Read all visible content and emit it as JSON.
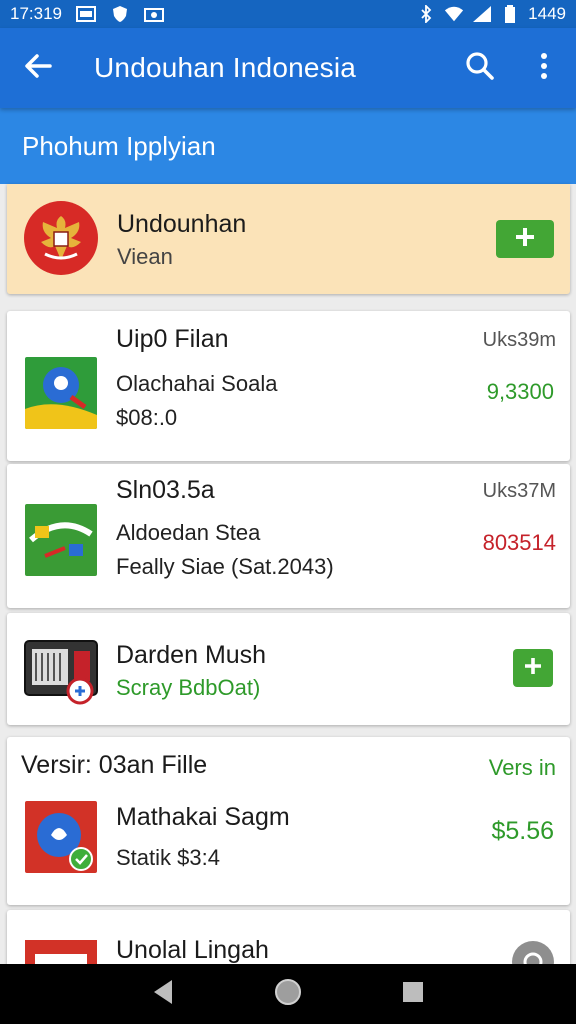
{
  "status_bar": {
    "time": "17:319",
    "battery_time": "1449",
    "icons_left": [
      "image-icon",
      "shield-icon",
      "photo-icon"
    ],
    "icons_right": [
      "bluetooth-icon",
      "wifi-icon",
      "signal-icon",
      "battery-icon"
    ]
  },
  "app_bar": {
    "title": "Undouhan Indonesia",
    "icons": [
      "back-arrow-icon",
      "search-icon",
      "more-vert-icon"
    ]
  },
  "sub_header": {
    "label": "Phohum Ipplyian"
  },
  "featured": {
    "title": "Undounhan",
    "subtitle": "Viean",
    "icon": "garuda-emblem-icon",
    "action_icon": "plus-icon"
  },
  "items": [
    {
      "title": "Uip0 Filan",
      "size": "Uks39m",
      "line1": "Olachahai Soala",
      "line2": "$08:.0",
      "price": "9,3300",
      "price_color": "#2e9a2a",
      "icon": "map-app-icon"
    },
    {
      "title": "Sln03.5a",
      "size": "Uks37M",
      "line1": "Aldoedan Stea",
      "line2": "Feally Siae (Sat.2043)",
      "price": "803514",
      "price_color": "#c5222a",
      "icon": "game-app-icon"
    },
    {
      "title": "Darden Mush",
      "subtitle": "Scray BdbOat)",
      "icon": "radio-app-icon",
      "action_icon": "plus-icon"
    }
  ],
  "version_card": {
    "header": "Versir: 03an Fille",
    "header_right": "Vers in",
    "title": "Mathakai Sagm",
    "subtitle": "Statik $3:4",
    "price": "$5.56",
    "icon": "bird-app-icon"
  },
  "partial_item": {
    "title": "Unolal Lingah",
    "icon": "red-app-icon",
    "action_icon": "download-circle-icon"
  },
  "nav_bar": {
    "icons": [
      "back-triangle-icon",
      "home-circle-icon",
      "recents-square-icon"
    ]
  },
  "colors": {
    "status_bar": "#1565c0",
    "app_bar": "#1e6fd6",
    "sub_header": "#2c87e4",
    "featured_bg": "#fbe3b8",
    "accent_green": "#43a635"
  }
}
